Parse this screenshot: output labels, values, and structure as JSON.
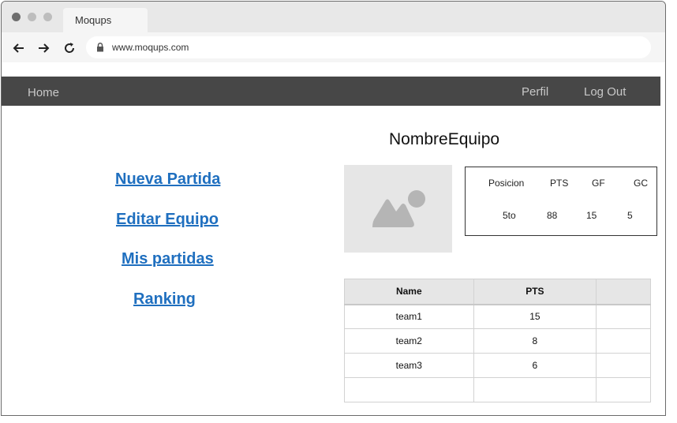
{
  "browser": {
    "tab_title": "Moqups",
    "url": "www.moqups.com"
  },
  "navbar": {
    "home": "Home",
    "profile": "Perfil",
    "logout": "Log Out"
  },
  "sidebar": {
    "links": [
      "Nueva Partida",
      "Editar Equipo",
      "Mis partidas",
      "Ranking"
    ]
  },
  "team": {
    "name": "NombreEquipo",
    "stats_headers": [
      "Posicion",
      "PTS",
      "GF",
      "GC"
    ],
    "stats_values": [
      "5to",
      "88",
      "15",
      "5"
    ]
  },
  "ranking_table": {
    "headers": [
      "Name",
      "PTS",
      ""
    ],
    "rows": [
      [
        "team1",
        "15",
        ""
      ],
      [
        "team2",
        "8",
        ""
      ],
      [
        "team3",
        "6",
        ""
      ],
      [
        "",
        "",
        ""
      ]
    ]
  },
  "colors": {
    "navbar_bg": "#474747",
    "link": "#1f6fbf",
    "placeholder_bg": "#e6e6e6"
  }
}
